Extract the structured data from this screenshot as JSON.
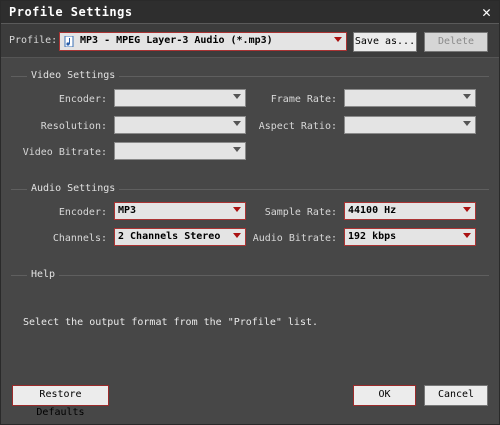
{
  "window": {
    "title": "Profile Settings",
    "close_icon": "close-icon"
  },
  "profile": {
    "label": "Profile:",
    "value": "MP3 - MPEG Layer-3 Audio (*.mp3)",
    "icon": "music-file-icon",
    "save_as_label": "Save as...",
    "delete_label": "Delete"
  },
  "video": {
    "section_title": "Video Settings",
    "encoder": {
      "label": "Encoder:",
      "value": ""
    },
    "frame_rate": {
      "label": "Frame Rate:",
      "value": ""
    },
    "resolution": {
      "label": "Resolution:",
      "value": ""
    },
    "aspect_ratio": {
      "label": "Aspect Ratio:",
      "value": ""
    },
    "video_bitrate": {
      "label": "Video Bitrate:",
      "value": ""
    }
  },
  "audio": {
    "section_title": "Audio Settings",
    "encoder": {
      "label": "Encoder:",
      "value": "MP3"
    },
    "sample_rate": {
      "label": "Sample Rate:",
      "value": "44100 Hz"
    },
    "channels": {
      "label": "Channels:",
      "value": "2 Channels Stereo"
    },
    "audio_bitrate": {
      "label": "Audio Bitrate:",
      "value": "192 kbps"
    }
  },
  "help": {
    "section_title": "Help",
    "text": "Select the output format from the \"Profile\" list."
  },
  "footer": {
    "restore_label": "Restore Defaults",
    "ok_label": "OK",
    "cancel_label": "Cancel"
  },
  "colors": {
    "accent_border": "#a33333",
    "background": "#474747",
    "titlebar": "#2e2e2e"
  }
}
